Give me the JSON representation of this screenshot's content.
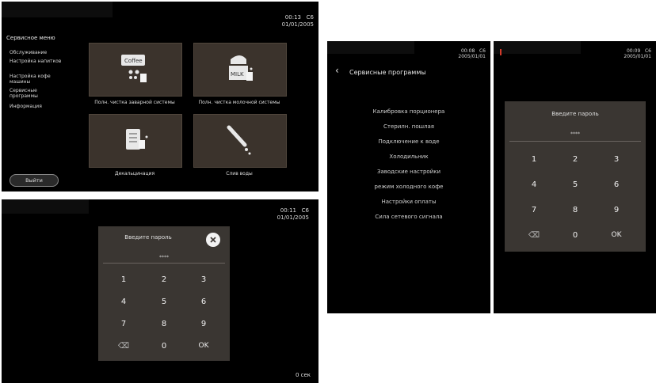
{
  "panel1": {
    "clock_time": "00:13   C6",
    "clock_date": "01/01/2005",
    "menu_title": "Сервисное меню",
    "menu_items": [
      "Обслуживание",
      "Настройка напитков",
      "Настройка кофе машины",
      "Сервисные программы",
      "Информация"
    ],
    "tiles": [
      {
        "caption": "Полн. чистка заварной системы",
        "icon": "coffee-cleaning-icon",
        "label": "Coffee"
      },
      {
        "caption": "Полн. чистка молочной системы",
        "icon": "milk-cleaning-icon",
        "label": "MILK"
      },
      {
        "caption": "Декальцинация",
        "icon": "decalcification-icon"
      },
      {
        "caption": "Слив воды",
        "icon": "water-drain-icon"
      }
    ],
    "exit_label": "Выйти"
  },
  "panel2": {
    "clock_time": "00:11   C6",
    "clock_date": "01/01/2005",
    "dialog_title": "Введите пароль",
    "password_mask": "****",
    "keys": [
      "1",
      "2",
      "3",
      "4",
      "5",
      "6",
      "7",
      "8",
      "9",
      "⌫",
      "0",
      "OK"
    ],
    "timer": "0 сек"
  },
  "panel3": {
    "clock_time": "00:08   C6",
    "clock_date": "2005/01/01",
    "title": "Сервисные программы",
    "items": [
      "Калибровка порционера",
      "Стерилн. пошлая",
      "Подключение к воде",
      "Холодильник",
      "Заводские настройки",
      "режим холодного кофе",
      "Настройки оплаты",
      "Сила сетевого сигнала"
    ]
  },
  "panel4": {
    "clock_time": "00:09   C6",
    "clock_date": "2005/01/01",
    "dialog_title": "Введите пароль",
    "password_mask": "****",
    "keys": [
      "1",
      "2",
      "3",
      "4",
      "5",
      "6",
      "7",
      "8",
      "9",
      "⌫",
      "0",
      "OK"
    ]
  }
}
